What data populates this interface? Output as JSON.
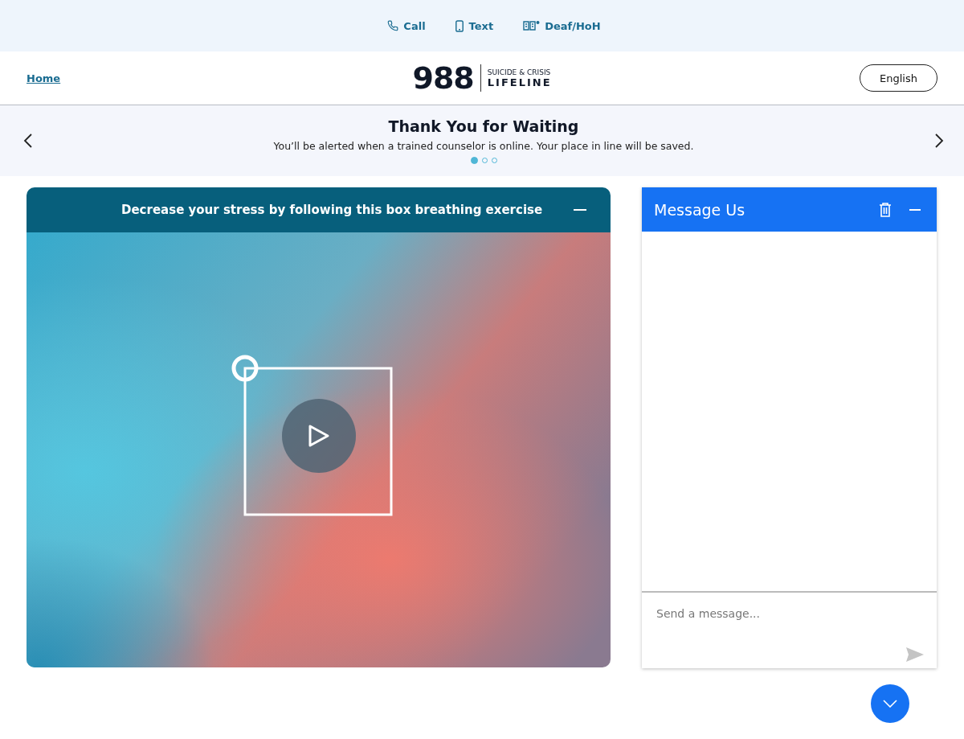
{
  "contact_bar": [
    {
      "kind": "call",
      "label": "Call"
    },
    {
      "kind": "text",
      "label": "Text"
    },
    {
      "kind": "deaf",
      "label": "Deaf/HoH"
    }
  ],
  "header": {
    "home_link": "Home",
    "logo": {
      "number": "988",
      "line1": "SUICIDE & CRISIS",
      "line2": "LIFELINE"
    },
    "language_button": "English"
  },
  "banner": {
    "title": "Thank You for Waiting",
    "message": "You’ll be alerted when a trained counselor is online. Your place in line will be saved.",
    "dots": [
      {
        "selected": true
      },
      {
        "selected": false
      },
      {
        "selected": false
      }
    ]
  },
  "exercise_card": {
    "title": "Decrease your stress by following this box breathing exercise"
  },
  "chat": {
    "title": "Message Us",
    "input": {
      "placeholder": "Send a message..."
    }
  }
}
